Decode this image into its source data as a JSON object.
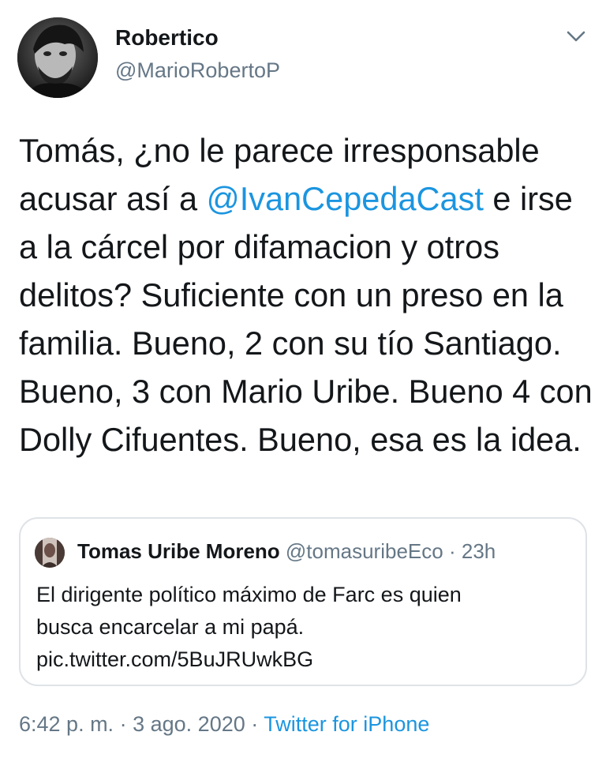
{
  "author": {
    "display_name": "Robertico",
    "handle": "@MarioRobertoP",
    "avatar_icon": "profile-photo-avatar"
  },
  "tweet": {
    "text_before_mention": "Tomás, ¿no le parece irresponsable acusar así a ",
    "mention": "@IvanCepedaCast",
    "text_after_mention": " e irse a la cárcel por difamacion y otros delitos? Suficiente con un preso en la familia. Bueno, 2 con su tío Santiago. Bueno, 3 con Mario Uribe. Bueno 4 con Dolly Cifuentes. Bueno, esa es la idea.",
    "menu_icon": "chevron-down-icon"
  },
  "quoted_tweet": {
    "display_name": "Tomas Uribe Moreno",
    "handle": "@tomasuribeEco",
    "separator": "·",
    "time": "23h",
    "text_line_1": "El dirigente político máximo de Farc es quien",
    "text_line_2": "busca encarcelar a mi papá.",
    "link": "pic.twitter.com/5BuJRUwkBG"
  },
  "meta": {
    "time": "6:42 p. m.",
    "separator": "·",
    "date": "3 ago. 2020",
    "source": "Twitter for iPhone"
  },
  "colors": {
    "link_blue": "#1b95e0",
    "secondary_gray": "#657786",
    "text_dark": "#14171a",
    "border_gray": "#dfe3e7"
  }
}
